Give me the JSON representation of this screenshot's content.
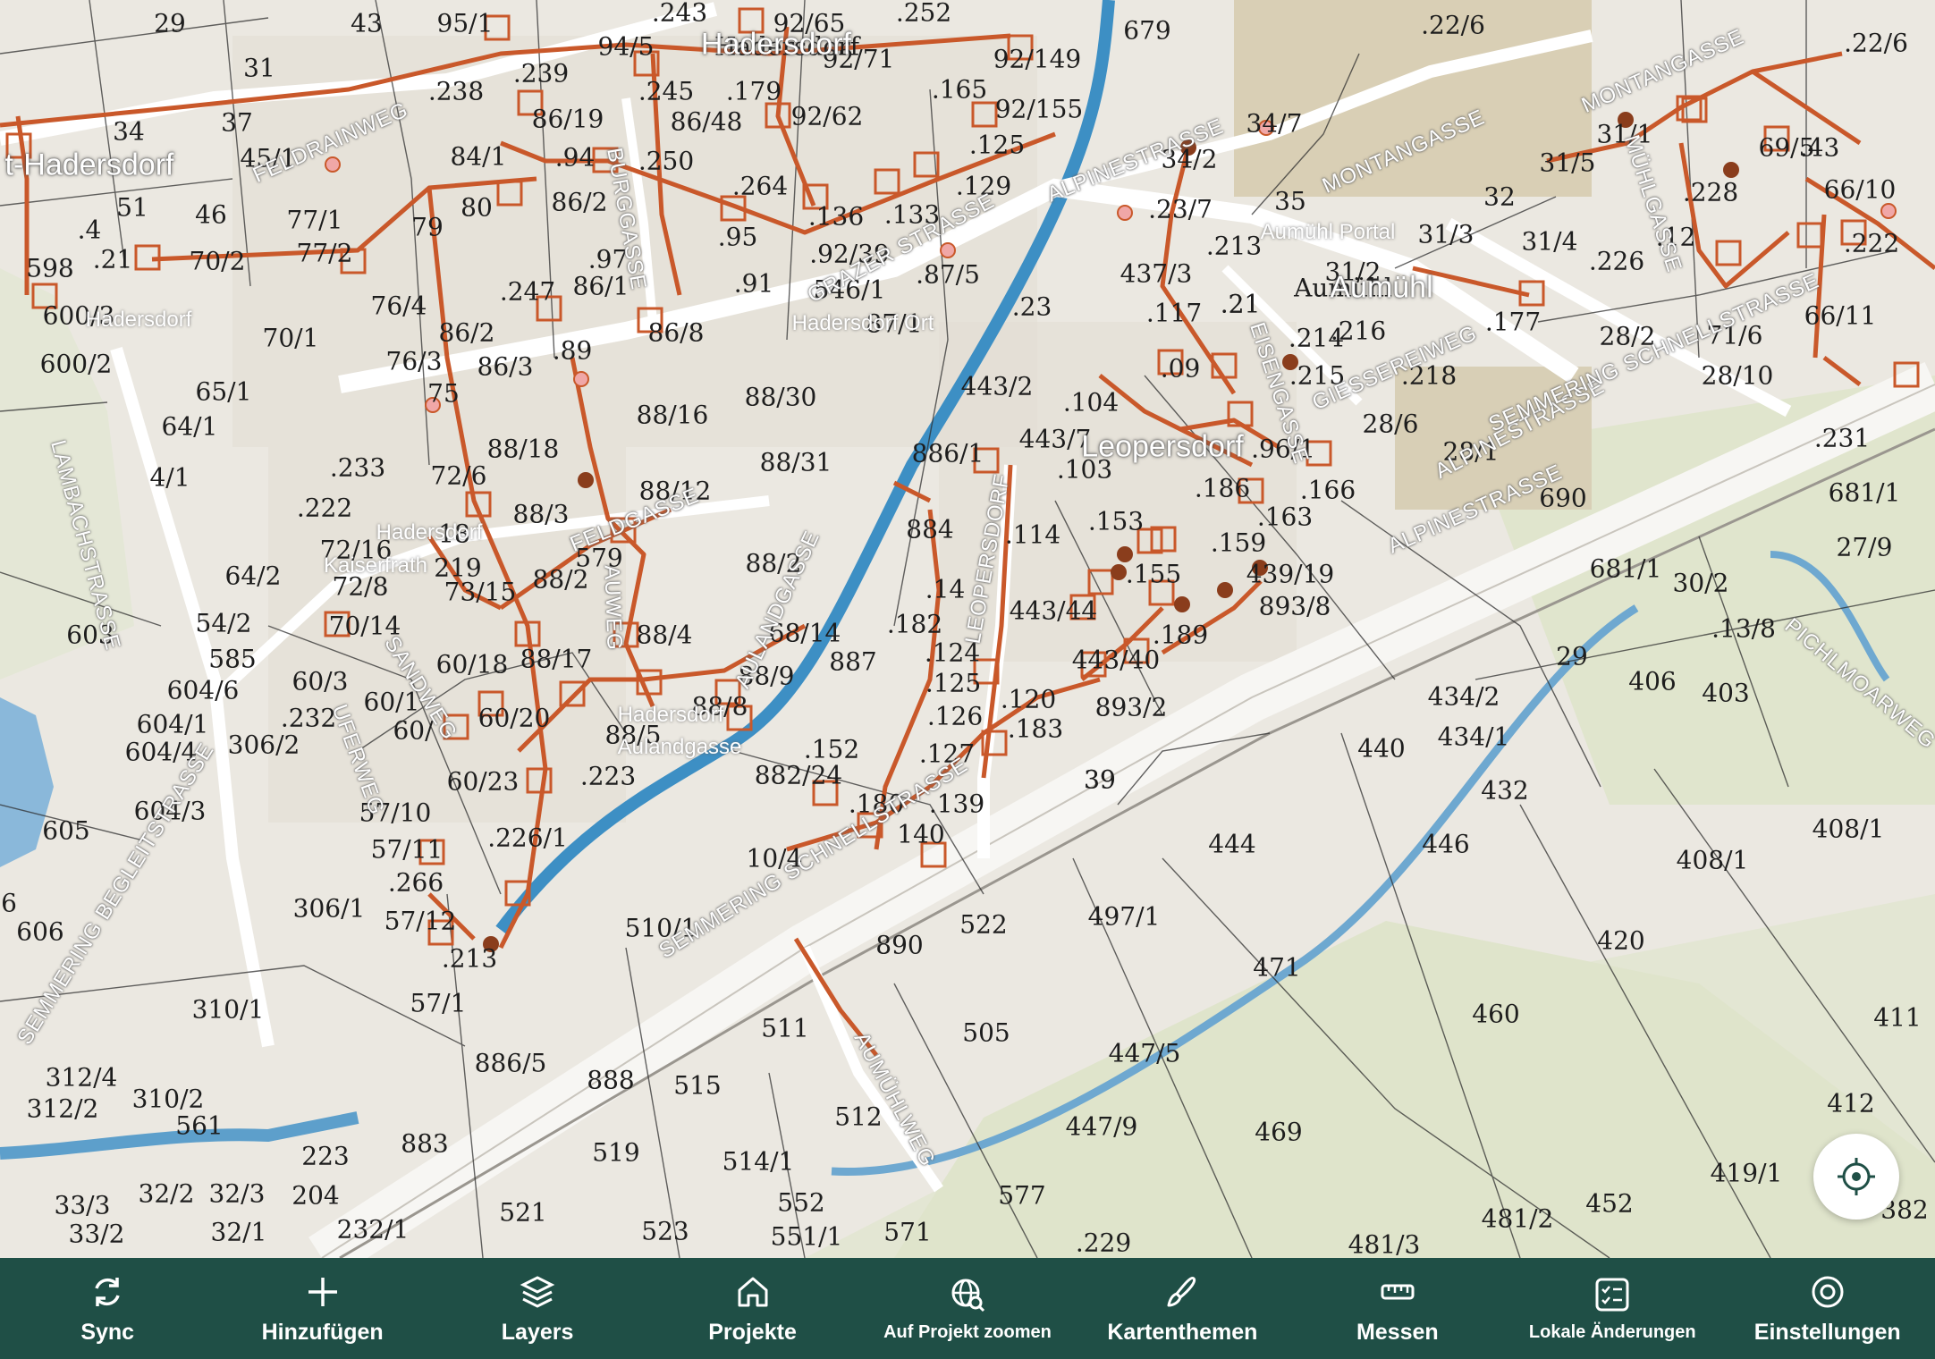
{
  "map": {
    "places": [
      "Hadersdorf",
      "Leopersdorf",
      "Aumühl",
      "t-Hadersdorf"
    ],
    "subplaces": [
      "Aumühl Portal",
      "Hadersdorf",
      "Hadersdorf Ort",
      "Aulandgasse",
      "Hadersdorf",
      "Kaiserfrath",
      "Hadersdorf"
    ],
    "streets": [
      "FELDRAINWEG",
      "BURGGASSE",
      "GRAZER STRASSE",
      "ALPINESTRASSE",
      "MONTANGASSE",
      "MONTANGASSE",
      "MÜHLGASSE",
      "EISENGASSE",
      "GIESSEREIWEG",
      "ALPINESTRASSE",
      "ALPINESTRASSE",
      "SEMMERING SCHNELLSTRASSE",
      "LAMBACHSTRASSE",
      "FELDGASSE",
      "AUWEG",
      "AULANDGASSE",
      "SANDWEG",
      "UFERWEG",
      "SEMMERING BEGLEITSTRASSE",
      "LEOPERSDORF",
      "SEMMERING SCHNELLSTRASSE",
      "AUMÜHLWEG",
      "PICHLMOARWEG"
    ],
    "parcels": [
      "29",
      "43",
      "95/1",
      ".243",
      "92/65",
      ".252",
      "679",
      ".22/6",
      ".22/6",
      "31",
      "39",
      "94/5",
      "Hadersdorf",
      "92/71",
      "92/149",
      ".238",
      ".239",
      ".245",
      ".179",
      ".165",
      "92/155",
      "34/7",
      "34",
      "37",
      "86/19",
      "86/48",
      "92/62",
      ".125",
      "69/5",
      ".43",
      "45/1",
      "84/1",
      ".94",
      ".250",
      ".264",
      ".129",
      "34/2",
      "31/1",
      "66/10",
      "51",
      "80",
      "86/2",
      ".95",
      ".133",
      "35",
      "32",
      "31/5",
      ".228",
      "46",
      "77/1",
      "79",
      ".136",
      ".23/7",
      ".213",
      ".21",
      "31/3",
      "31/4",
      ".12",
      ".222",
      ".4",
      ".21",
      "70/2",
      "77/2",
      ".97",
      ".92/39",
      ".87/5",
      "437/3",
      "31/2",
      ".226",
      "598",
      ".247",
      "86/1",
      ".91",
      "546/1",
      ".117",
      ".23",
      "Aumühl",
      ".177",
      "28/2",
      "600/3",
      "76/4",
      "86/2",
      "86/8",
      ".21",
      ".214",
      ".216",
      "66/11",
      "71/6",
      "600/2",
      "70/1",
      "86/3",
      ".89",
      "87/1",
      ".09",
      ".215",
      ".218",
      "28/10",
      "65/1",
      "76/3",
      "88/16",
      "88/30",
      "443/2",
      ".104",
      "28/6",
      "64/1",
      "75",
      "88/18",
      "886/1",
      "443/7",
      ".103",
      ".96/1",
      "28/1",
      ".231",
      "4/1",
      ".233",
      "72/6",
      "88/12",
      "88/31",
      ".186",
      ".166",
      "690",
      "681/1",
      ".222",
      "88/3",
      ".153",
      ".163",
      "72/16",
      "18",
      "88/2",
      "579",
      "884",
      ".114",
      ".159",
      "27/9",
      "681/1",
      "64/2",
      "219",
      "88/2",
      "72/8",
      ".155",
      "439/19",
      "30/2",
      "73/15",
      ".14",
      "443/44",
      "893/8",
      "54/2",
      "70/14",
      "88/17",
      "88/4",
      "68/14",
      ".182",
      ".189",
      ".13/8",
      "603",
      "585",
      "60/18",
      "88/9",
      "887",
      ".124",
      "443/40",
      "29",
      "406",
      "604/6",
      "60/3",
      "60/20",
      "88/8",
      ".125",
      ".120",
      "893/2",
      "434/2",
      "403",
      "604/1",
      ".232",
      "60/1",
      "88/5",
      ".126",
      ".183",
      "434/1",
      "604/4",
      "306/2",
      "60/",
      "60/23",
      ".223",
      "882/24",
      ".127",
      "39",
      "440",
      "432",
      "604/3",
      "57/10",
      ".152",
      ".180",
      ".139",
      "444",
      "446",
      "408/1",
      "605",
      "57/11",
      ".226/1",
      "10/4",
      "140",
      "408/1",
      ".266",
      "6",
      "306/1",
      "57/12",
      "510/1",
      "522",
      "497/1",
      "420",
      "606",
      ".213",
      "890",
      "471",
      "460",
      "411",
      "310/1",
      "57/1",
      "511",
      "505",
      "447/5",
      "312/4",
      "886/5",
      "888",
      "515",
      "310/2",
      "412",
      "312/2",
      "561",
      "512",
      "447/9",
      "469",
      "223",
      "883",
      "519",
      "514/1",
      "419/1",
      "4",
      "382",
      "33/3",
      "32/2",
      "32/3",
      "204",
      "577",
      "452",
      "521",
      "552",
      "481/2",
      "33/2",
      "32/1",
      "232/1",
      "523",
      "551/1",
      "571",
      ".229",
      "481/3"
    ]
  },
  "locate_button": {
    "icon": "locate-icon"
  },
  "toolbar": {
    "items": [
      {
        "label": "Sync",
        "icon": "sync-icon"
      },
      {
        "label": "Hinzufügen",
        "icon": "plus-icon"
      },
      {
        "label": "Layers",
        "icon": "layers-icon"
      },
      {
        "label": "Projekte",
        "icon": "home-icon"
      },
      {
        "label": "Auf Projekt zoomen",
        "icon": "globe-search-icon"
      },
      {
        "label": "Kartenthemen",
        "icon": "brush-icon"
      },
      {
        "label": "Messen",
        "icon": "ruler-icon"
      },
      {
        "label": "Lokale Änderungen",
        "icon": "checklist-icon"
      },
      {
        "label": "Einstellungen",
        "icon": "settings-icon"
      }
    ]
  },
  "colors": {
    "toolbar_bg": "#1f4f46",
    "network": "#c9582a",
    "river": "#3d8fc4",
    "meadow": "#dfe5cc"
  }
}
